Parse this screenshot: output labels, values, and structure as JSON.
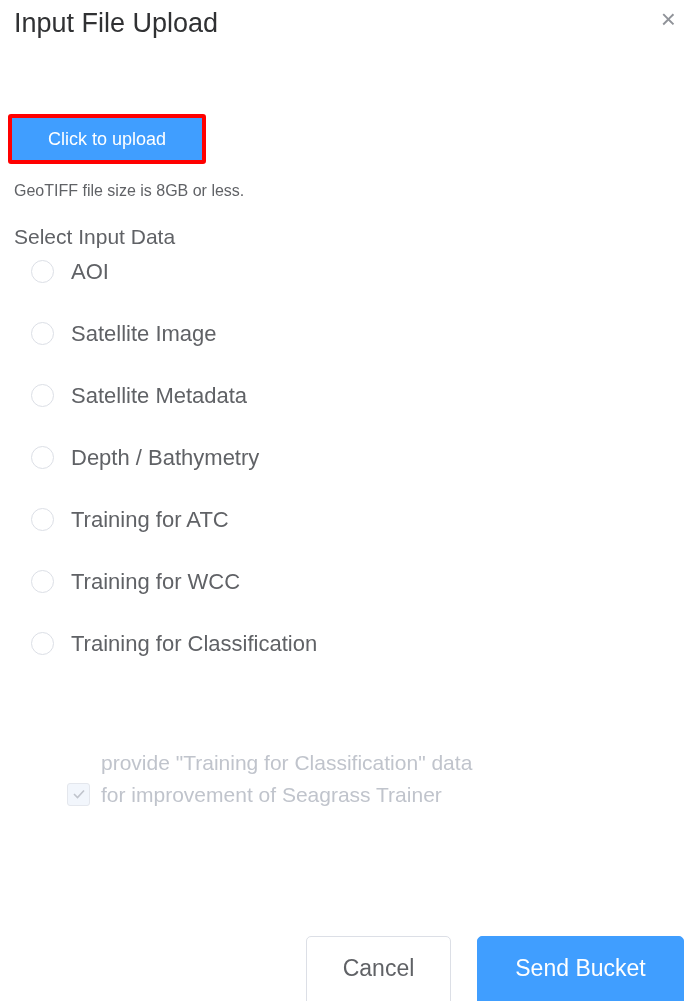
{
  "dialog": {
    "title": "Input File Upload",
    "close": "×"
  },
  "upload": {
    "label": "Click to upload",
    "highlighted": true,
    "hint": "GeoTIFF file size is 8GB or less."
  },
  "input_data": {
    "heading": "Select Input Data",
    "options": [
      {
        "label": "AOI",
        "selected": false
      },
      {
        "label": "Satellite Image",
        "selected": false
      },
      {
        "label": "Satellite Metadata",
        "selected": false
      },
      {
        "label": "Depth / Bathymetry",
        "selected": false
      },
      {
        "label": "Training for ATC",
        "selected": false
      },
      {
        "label": "Training for WCC",
        "selected": false
      },
      {
        "label": "Training for Classification",
        "selected": false
      }
    ]
  },
  "consent": {
    "lines": [
      "provide \"Training for Classification\" data",
      "for improvement of Seagrass Trainer"
    ],
    "checked": true,
    "disabled": true
  },
  "buttons": [
    {
      "label": "Cancel",
      "kind": "secondary"
    },
    {
      "label": "Send Bucket",
      "kind": "primary"
    }
  ]
}
